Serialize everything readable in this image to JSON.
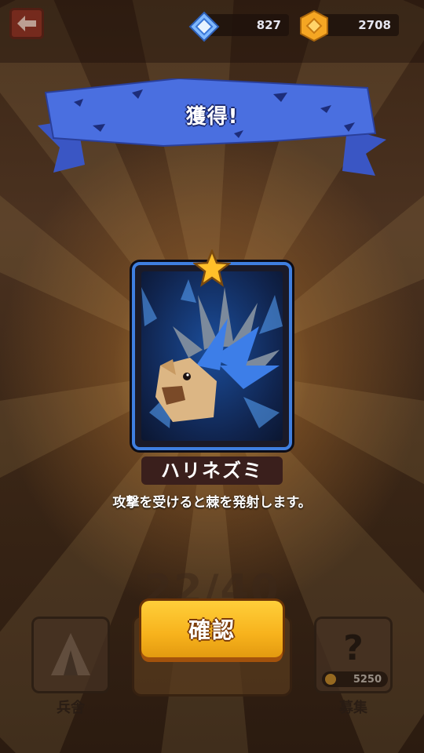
{
  "header": {
    "gems": "827",
    "coins": "2708",
    "back_icon": "back-arrow-icon"
  },
  "banner": {
    "title": "獲得!"
  },
  "unit": {
    "name": "ハリネズミ",
    "rarity_icon": "star-icon",
    "description": "攻撃を受けると棘を発射します。"
  },
  "confirm": {
    "label": "確認"
  },
  "background": {
    "unit_count": "22/40",
    "left_tile_label": "兵舎",
    "right_tile_label": "募集",
    "recruit_price": "5250"
  },
  "colors": {
    "banner_blue": "#4a6fe0",
    "card_border": "#3f7fe0",
    "button_yellow": "#f7b21c"
  }
}
